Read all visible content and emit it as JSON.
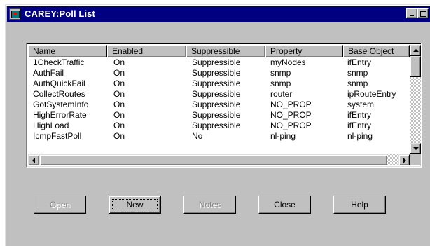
{
  "window": {
    "title": "CAREY:Poll List",
    "title_bar_color": "#000080",
    "face_color": "#c0c0c0"
  },
  "title_buttons": {
    "minimize_icon": "minimize-icon",
    "maximize_icon": "maximize-icon",
    "close_label": "×"
  },
  "list": {
    "columns": [
      "Name",
      "Enabled",
      "Suppressible",
      "Property",
      "Base Object"
    ],
    "rows": [
      [
        "1CheckTraffic",
        "On",
        "Suppressible",
        "myNodes",
        "ifEntry"
      ],
      [
        "AuthFail",
        "On",
        "Suppressible",
        "snmp",
        "snmp"
      ],
      [
        "AuthQuickFail",
        "On",
        "Suppressible",
        "snmp",
        "snmp"
      ],
      [
        "CollectRoutes",
        "On",
        "Suppressible",
        "router",
        "ipRouteEntry"
      ],
      [
        "GotSystemInfo",
        "On",
        "Suppressible",
        "NO_PROP",
        "system"
      ],
      [
        "HighErrorRate",
        "On",
        "Suppressible",
        "NO_PROP",
        "ifEntry"
      ],
      [
        "HighLoad",
        "On",
        "Suppressible",
        "NO_PROP",
        "ifEntry"
      ],
      [
        "IcmpFastPoll",
        "On",
        "No",
        "nl-ping",
        "nl-ping"
      ]
    ]
  },
  "buttons": {
    "open": "Open",
    "new": "New",
    "notes": "Notes",
    "close": "Close",
    "help": "Help"
  }
}
